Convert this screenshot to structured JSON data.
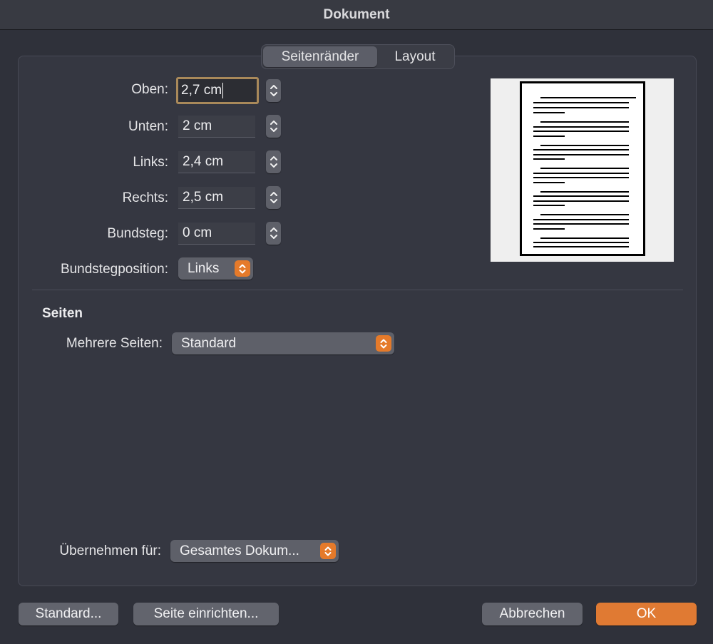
{
  "window": {
    "title": "Dokument"
  },
  "tabs": [
    {
      "label": "Seitenränder",
      "active": true
    },
    {
      "label": "Layout",
      "active": false
    }
  ],
  "margins": {
    "top": {
      "label": "Oben:",
      "value": "2,7 cm"
    },
    "bottom": {
      "label": "Unten:",
      "value": "2 cm"
    },
    "left": {
      "label": "Links:",
      "value": "2,4 cm"
    },
    "right": {
      "label": "Rechts:",
      "value": "2,5 cm"
    },
    "gutter": {
      "label": "Bundsteg:",
      "value": "0 cm"
    },
    "gutter_position": {
      "label": "Bundstegposition:",
      "value": "Links"
    }
  },
  "pages_section": {
    "heading": "Seiten",
    "multiple_pages": {
      "label": "Mehrere Seiten:",
      "value": "Standard"
    }
  },
  "apply_to": {
    "label": "Übernehmen für:",
    "value": "Gesamtes Dokum..."
  },
  "buttons": {
    "default": "Standard...",
    "page_setup": "Seite einrichten...",
    "cancel": "Abbrechen",
    "ok": "OK"
  },
  "colors": {
    "accent": "#e57a2a",
    "focus_ring": "#a9895a",
    "background": "#2f313a"
  },
  "icons": {
    "stepper": "stepper-arrows-icon",
    "popup": "popup-chevron-icon"
  }
}
